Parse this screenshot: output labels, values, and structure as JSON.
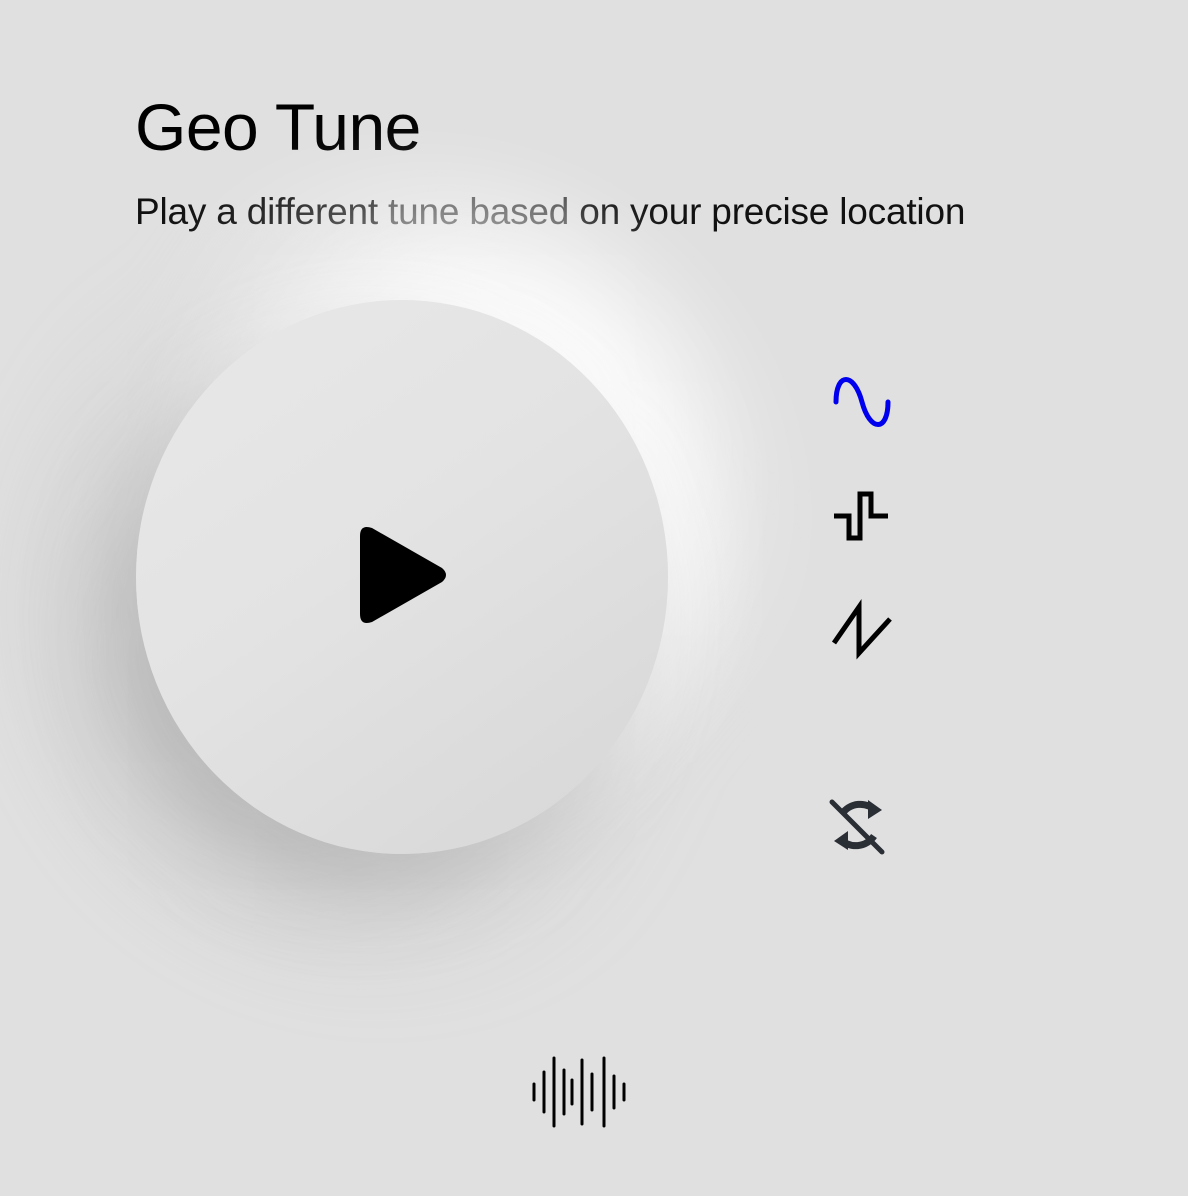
{
  "app": {
    "title": "Geo Tune",
    "subtitle_part1": "Play a different ",
    "subtitle_part2": "tune based",
    "subtitle_part3": " on your precise location"
  },
  "player": {
    "play_icon": "play-icon"
  },
  "waveforms": [
    {
      "name": "sine",
      "icon": "sine-wave-icon",
      "selected": true,
      "color": "#0000ee"
    },
    {
      "name": "square",
      "icon": "square-wave-icon",
      "selected": false,
      "color": "#000000"
    },
    {
      "name": "sawtooth",
      "icon": "sawtooth-wave-icon",
      "selected": false,
      "color": "#000000"
    }
  ],
  "loop": {
    "icon": "repeat-off-icon",
    "enabled": false,
    "color": "#2a2e35"
  },
  "footer": {
    "icon": "audio-waveform-icon"
  },
  "colors": {
    "background": "#e0e0e0",
    "accent": "#0000ee"
  }
}
